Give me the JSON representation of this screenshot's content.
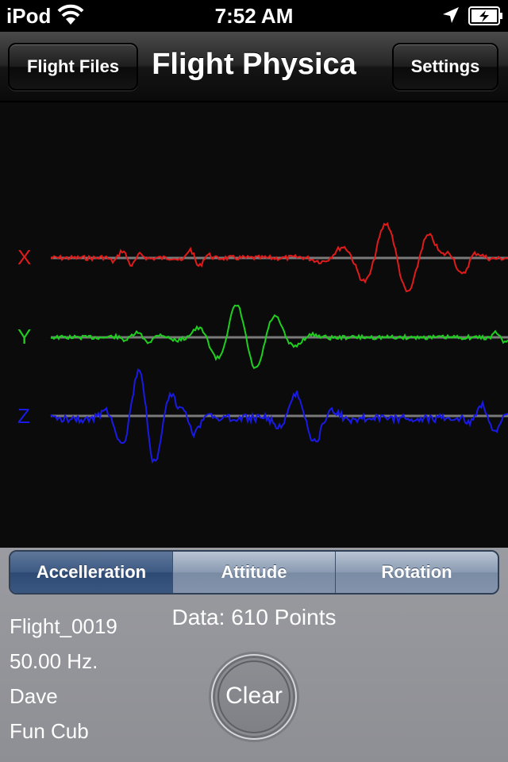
{
  "status_bar": {
    "carrier": "iPod",
    "time": "7:52 AM",
    "icons": [
      "wifi-icon",
      "location-arrow-icon",
      "battery-charging-icon"
    ]
  },
  "nav_bar": {
    "left_button": "Flight Files",
    "title": "Flight Physica",
    "right_button": "Settings"
  },
  "graph": {
    "channels": [
      {
        "label": "X",
        "color": "#e01b1b"
      },
      {
        "label": "Y",
        "color": "#1ed01e"
      },
      {
        "label": "Z",
        "color": "#1a1ae6"
      }
    ],
    "baseline_color": "#7a7a7a",
    "background": "#0b0b0b"
  },
  "segments": [
    {
      "label": "Accelleration",
      "selected": true
    },
    {
      "label": "Attitude",
      "selected": false
    },
    {
      "label": "Rotation",
      "selected": false
    }
  ],
  "flight_info": {
    "name": "Flight_0019",
    "rate": "50.00 Hz.",
    "pilot": "Dave",
    "aircraft": "Fun Cub"
  },
  "data_label": "Data: 610 Points",
  "clear_button": "Clear"
}
